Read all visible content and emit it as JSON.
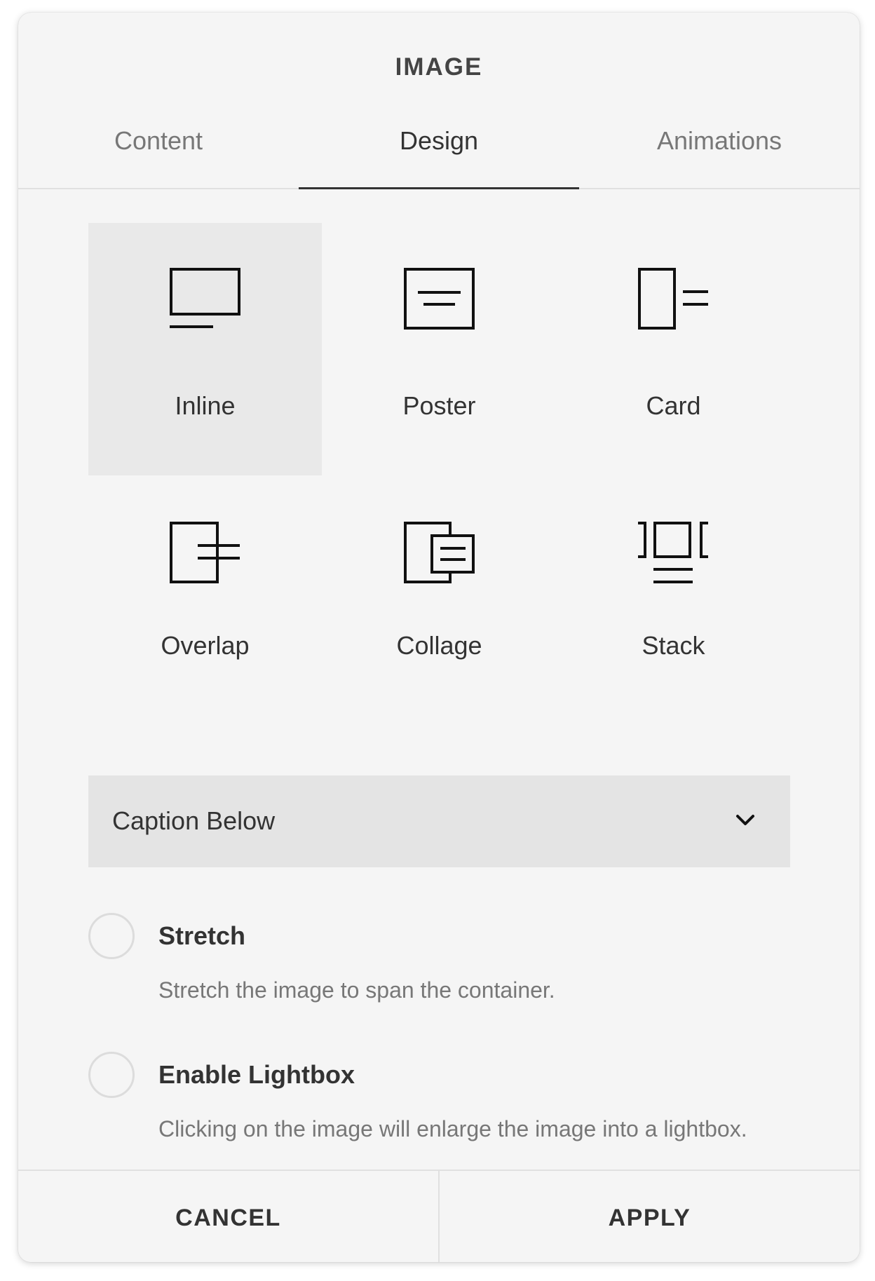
{
  "title": "IMAGE",
  "tabs": [
    {
      "label": "Content",
      "active": false
    },
    {
      "label": "Design",
      "active": true
    },
    {
      "label": "Animations",
      "active": false
    }
  ],
  "layouts": [
    {
      "label": "Inline",
      "icon": "inline-layout-icon",
      "selected": true
    },
    {
      "label": "Poster",
      "icon": "poster-layout-icon",
      "selected": false
    },
    {
      "label": "Card",
      "icon": "card-layout-icon",
      "selected": false
    },
    {
      "label": "Overlap",
      "icon": "overlap-layout-icon",
      "selected": false
    },
    {
      "label": "Collage",
      "icon": "collage-layout-icon",
      "selected": false
    },
    {
      "label": "Stack",
      "icon": "stack-layout-icon",
      "selected": false
    }
  ],
  "caption_select": {
    "value": "Caption Below",
    "icon": "chevron-down-icon"
  },
  "options": [
    {
      "title": "Stretch",
      "description": "Stretch the image to span the container.",
      "checked": false
    },
    {
      "title": "Enable Lightbox",
      "description": "Clicking on the image will enlarge the image into a lightbox.",
      "checked": false
    }
  ],
  "footer": {
    "cancel_label": "CANCEL",
    "apply_label": "APPLY"
  }
}
